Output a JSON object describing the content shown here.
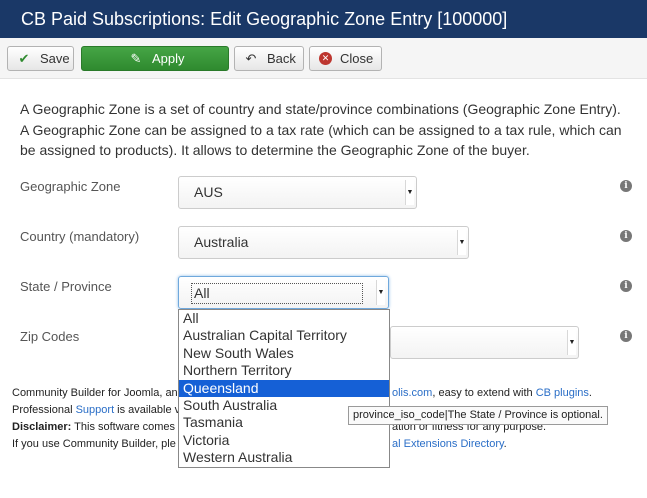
{
  "window": {
    "title": "CB Paid Subscriptions: Edit Geographic Zone Entry [100000]"
  },
  "toolbar": {
    "save_label": "Save",
    "apply_label": "Apply",
    "back_label": "Back",
    "close_label": "Close",
    "save_icon": "check-icon",
    "apply_icon": "edit-icon",
    "back_icon": "undo-icon",
    "close_icon": "close-circle-icon",
    "apply_color": "#46a546"
  },
  "intro": {
    "text": "A Geographic Zone is a set of country and state/province combinations (Geographic Zone Entry). A Geographic Zone can be assigned to a tax rate (which can be assigned to a tax rule, which can be assigned to products). It allows to determine the Geographic Zone of the buyer."
  },
  "form": {
    "zone_label": "Geographic Zone",
    "zone_value": "AUS",
    "country_label": "Country (mandatory)",
    "country_value": "Australia",
    "state_label": "State / Province",
    "state_value": "All",
    "zip_label": "Zip Codes",
    "info_icon_glyph": "i"
  },
  "dropdown": {
    "options": [
      "All",
      "Australian Capital Territory",
      "New South Wales",
      "Northern Territory",
      "Queensland",
      "South Australia",
      "Tasmania",
      "Victoria",
      "Western Australia"
    ],
    "highlighted": "Queensland"
  },
  "tooltip": {
    "text": "province_iso_code|The State / Province is optional."
  },
  "footer": {
    "line1_start": "Community Builder for Joomla, an",
    "line1_link1": "olis.com",
    "line1_mid": ", easy to extend with ",
    "line1_link2": "CB plugins",
    "line1_end": ".",
    "line2_start": "Professional ",
    "line2_link": "Support",
    "line2_end": " is available v",
    "line3_bold": "Disclaimer:",
    "line3_text": " This software comes",
    "line3_tail": "ation or fitness for any purpose.",
    "line4_start": "If you use Community Builder, ple",
    "line4_link": "al Extensions Directory",
    "line4_end": "."
  }
}
